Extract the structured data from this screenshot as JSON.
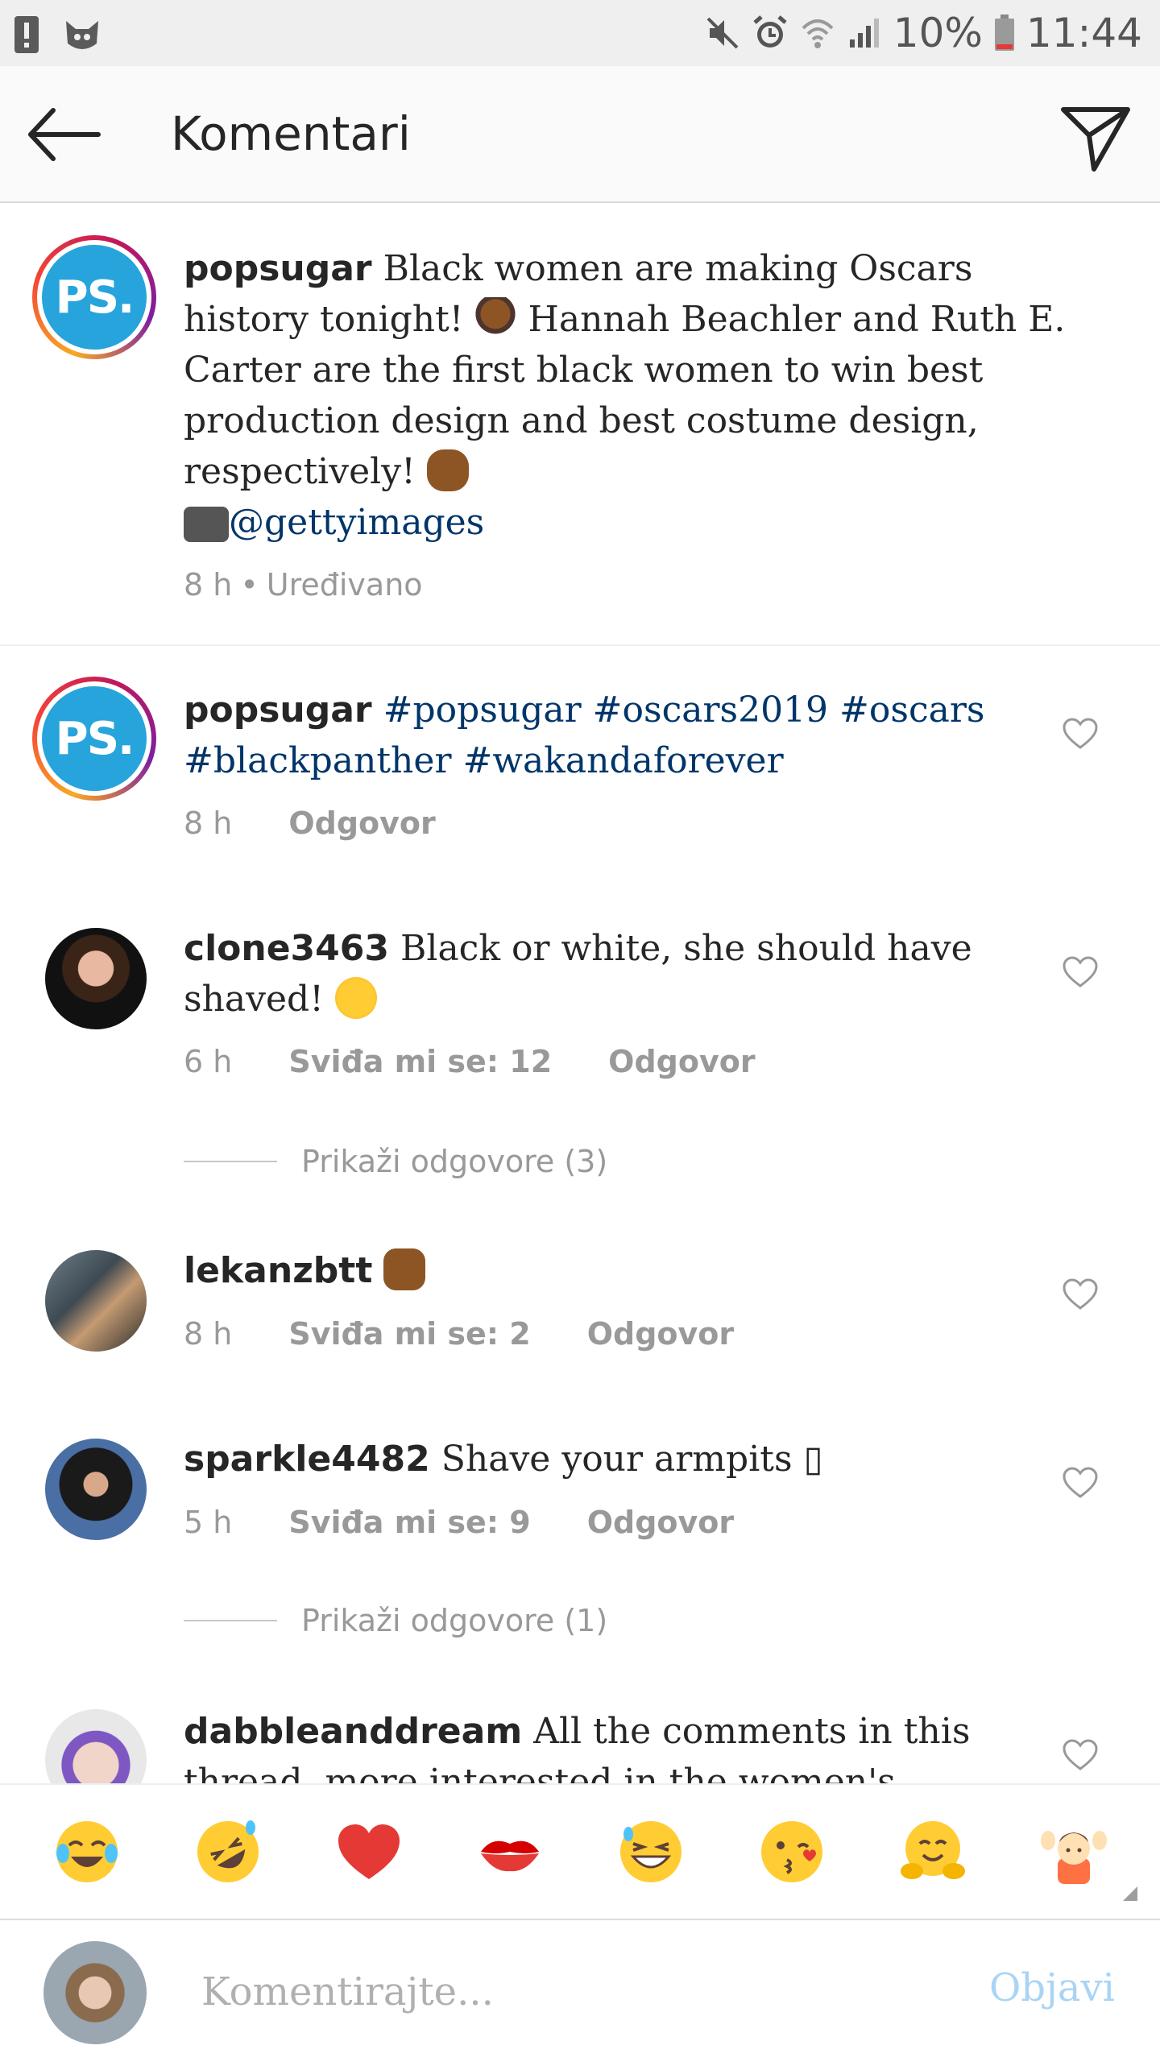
{
  "status_bar": {
    "battery_percent": "10%",
    "time": "11:44",
    "icons": [
      "alert-icon",
      "cat-app-icon",
      "mute-icon",
      "alarm-icon",
      "wifi-icon",
      "signal-icon",
      "battery-icon"
    ]
  },
  "header": {
    "title": "Komentari",
    "back_icon": "back-arrow-icon",
    "share_icon": "direct-send-icon"
  },
  "caption": {
    "username": "popsugar",
    "text_1": "Black women are making Oscars history tonight! ",
    "text_2": " Hannah Beachler and Ruth E. Carter are the first black women to win best production design and best costume design, respectively! ",
    "mention": "@gettyimages",
    "time": "8 h",
    "edited": "Uređivano"
  },
  "comments": [
    {
      "username": "popsugar",
      "tags": "#popsugar #oscars2019 #oscars #blackpanther #wakandaforever",
      "time": "8 h",
      "reply": "Odgovor"
    },
    {
      "username": "clone3463",
      "text": "Black or white, she should have shaved! ",
      "time": "6 h",
      "likes": "Sviđa mi se: 12",
      "reply": "Odgovor",
      "show_replies": "Prikaži odgovore (3)"
    },
    {
      "username": "lekanzbtt",
      "text": "",
      "time": "8 h",
      "likes": "Sviđa mi se: 2",
      "reply": "Odgovor"
    },
    {
      "username": "sparkle4482",
      "text": "Shave your armpits ▯",
      "time": "5 h",
      "likes": "Sviđa mi se: 9",
      "reply": "Odgovor",
      "show_replies": "Prikaži odgovore (1)"
    },
    {
      "username": "dabbleanddream",
      "text": "All the comments in this thread, more interested in the women's"
    }
  ],
  "quick_emojis": [
    "face-with-tears-of-joy",
    "rolling-on-floor-laughing",
    "red-heart",
    "kiss-mark",
    "grinning-squinting-sweat",
    "face-blowing-kiss",
    "hugging-face",
    "person-raising-hands"
  ],
  "composer": {
    "placeholder": "Komentirajte...",
    "post_label": "Objavi"
  },
  "colors": {
    "hashtag": "#003569",
    "meta_gray": "#999999",
    "post_disabled": "#a9d4f5",
    "popsugar_blue": "#27a4dc"
  }
}
